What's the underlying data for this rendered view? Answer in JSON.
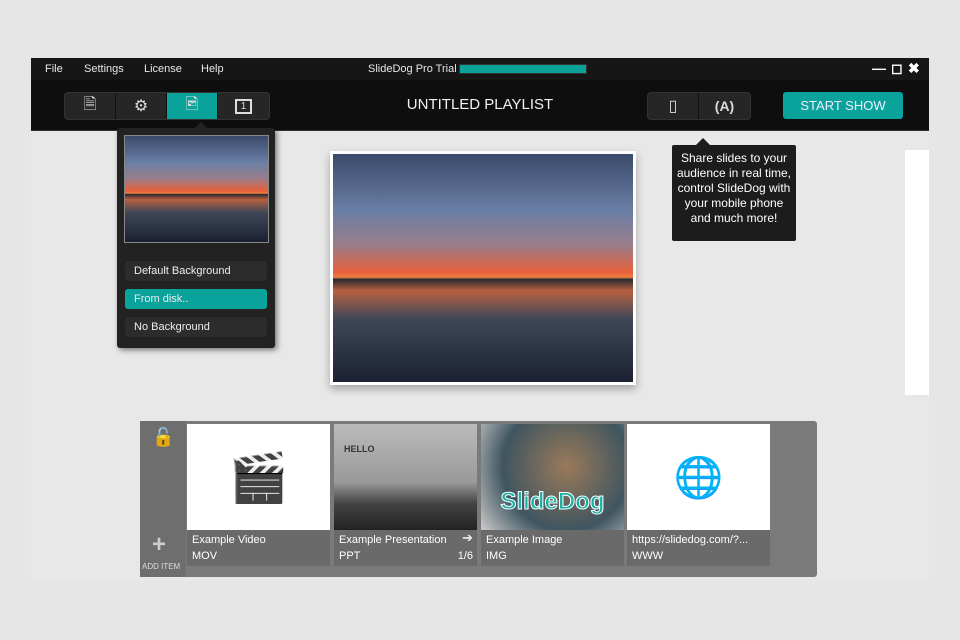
{
  "menu": {
    "items": [
      "File",
      "Settings",
      "License",
      "Help"
    ],
    "app_title": "SlideDog Pro Trial",
    "trial_progress": 1.0
  },
  "toolbar": {
    "playlist_title": "UNTITLED PLAYLIST",
    "start_label": "START SHOW",
    "monitor_number": "1"
  },
  "background_menu": {
    "options": [
      "Default Background",
      "From disk..",
      "No Background"
    ],
    "selected": "From disk.."
  },
  "tooltip": "Share slides to your audience in real time, control SlideDog with your mobile phone and much more!",
  "playlist": {
    "add_item": "ADD ITEM",
    "items": [
      {
        "name": "Example Video",
        "type": "MOV"
      },
      {
        "name": "Example Presentation",
        "type": "PPT",
        "pages": "1/6",
        "slide_text": "HELLO"
      },
      {
        "name": "Example Image",
        "type": "IMG",
        "logo": "SlideDog"
      },
      {
        "name": "https://slidedog.com/?...",
        "type": "WWW"
      }
    ]
  },
  "colors": {
    "accent": "#0aa39b",
    "toolbar": "#0e0e0e"
  }
}
